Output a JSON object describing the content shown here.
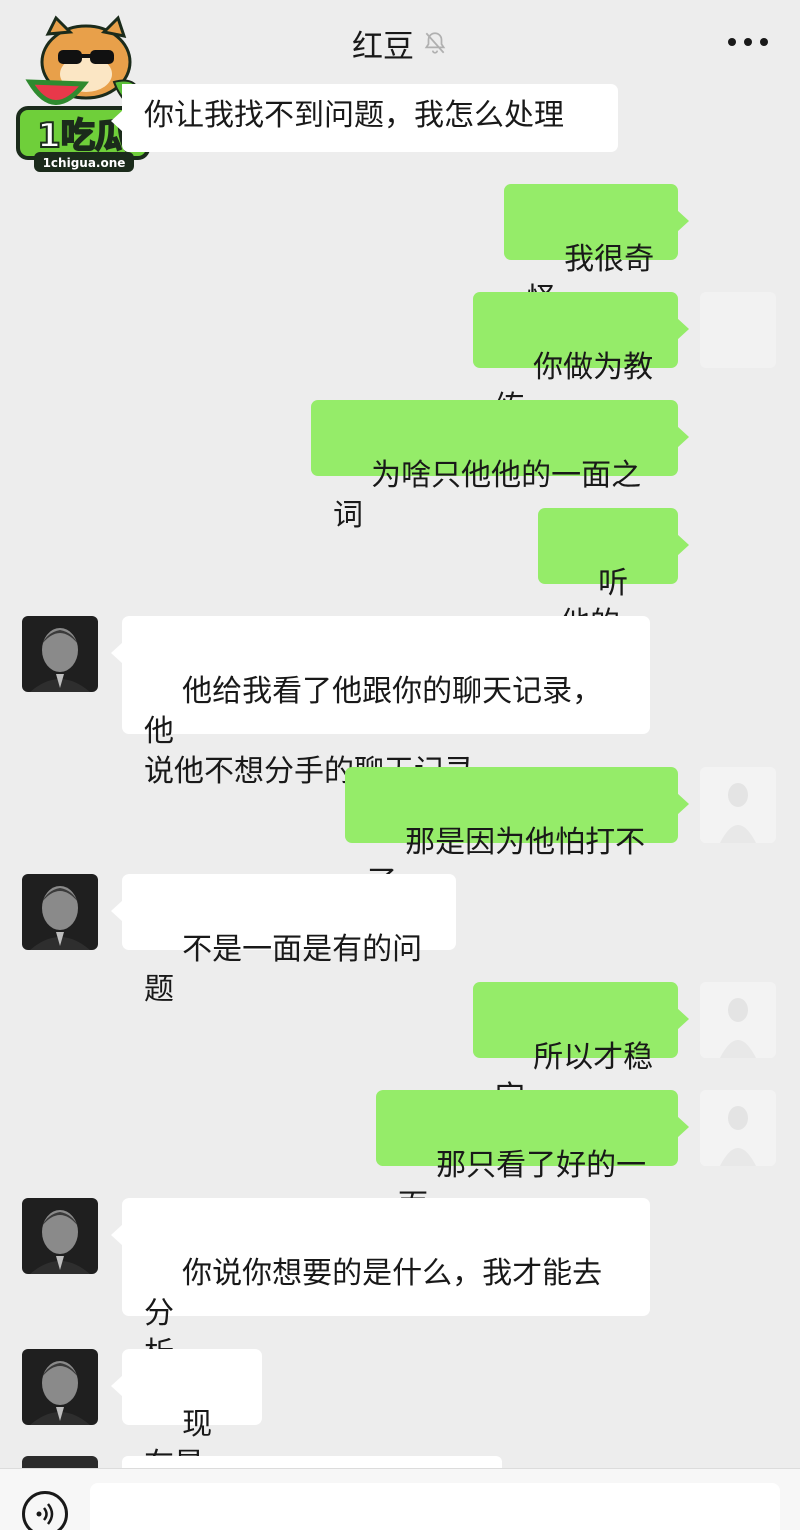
{
  "header": {
    "title": "红豆",
    "mute_icon": "bell-slash-icon",
    "more_icon": "ellipsis-icon"
  },
  "watermark": {
    "brand": "1吃瓜",
    "site": "1chigua.one"
  },
  "messages": [
    {
      "side": "left",
      "text": "你让我找不到问题，我怎么处理"
    },
    {
      "side": "right",
      "text": "我很奇怪"
    },
    {
      "side": "right",
      "text": "你做为教练"
    },
    {
      "side": "right",
      "text": "为啥只他他的一面之词"
    },
    {
      "side": "right",
      "text": "听他的"
    },
    {
      "side": "left",
      "text": "他给我看了他跟你的聊天记录，他\n说他不想分手的聊天记录"
    },
    {
      "side": "right",
      "text": "那是因为他怕打不了"
    },
    {
      "side": "left",
      "text": "不是一面是有的问题"
    },
    {
      "side": "right",
      "text": "所以才稳定"
    },
    {
      "side": "right",
      "text": "那只看了好的一面"
    },
    {
      "side": "left",
      "text": "你说你想要的是什么，我才能去分\n析"
    },
    {
      "side": "left",
      "text": "现在是"
    }
  ],
  "input_bar": {
    "voice_icon": "voice-wave-icon",
    "placeholder": ""
  },
  "colors": {
    "background": "#ededed",
    "bubble_self": "#95ec69",
    "bubble_other": "#ffffff"
  }
}
